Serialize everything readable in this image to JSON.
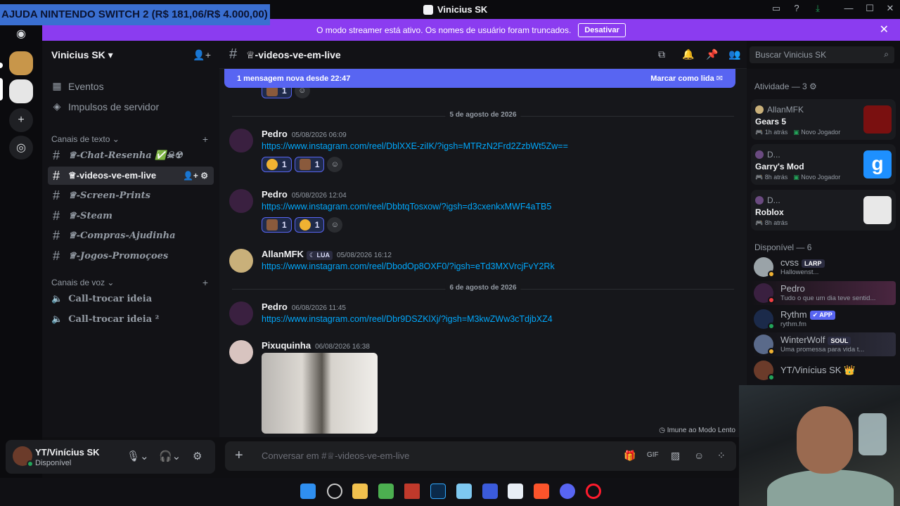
{
  "window": {
    "title": "Vinicius SK"
  },
  "stream_overlay_text": "AJUDA NINTENDO SWITCH 2 (R$ 181,06/R$ 4.000,00)",
  "streamer_bar": {
    "message": "O modo streamer está ativo. Os nomes de usuário foram truncados.",
    "button": "Desativar"
  },
  "server": {
    "name": "Vinicius SK"
  },
  "sidebar": {
    "events": "Eventos",
    "boosts": "Impulsos de servidor",
    "text_category": "Canais de texto",
    "voice_category": "Canais de voz",
    "text_channels": [
      "♕-Chat-Resenha ✅☠☢",
      "♕-videos-ve-em-live",
      "♕-Screen-Prints",
      "♕-Steam",
      "♕-Compras-Ajudinha",
      "♕-Jogos-Promoçoes"
    ],
    "voice_channels": [
      "Call-trocar ideia",
      "Call-trocar ideia ²"
    ]
  },
  "user_panel": {
    "name": "YT/Vinícius SK",
    "status": "Disponível"
  },
  "chat": {
    "channel_title": "♕-videos-ve-em-live",
    "new_messages": "1 mensagem nova desde 22:47",
    "mark_read": "Marcar como lida",
    "date_1": "5 de agosto de 2026",
    "date_2": "6 de agosto de 2026",
    "top_react_count": "1",
    "messages": [
      {
        "author": "Pedro",
        "time": "05/08/2026 06:09",
        "link": "https://www.instagram.com/reel/DblXXE-ziIK/?igsh=MTRzN2Frd2ZzbWt5Zw==",
        "react1": "1",
        "react2": "1"
      },
      {
        "author": "Pedro",
        "time": "05/08/2026 12:04",
        "link": "https://www.instagram.com/reel/DbbtqTosxow/?igsh=d3cxenkxMWF4aTB5",
        "react1": "1",
        "react2": "1"
      },
      {
        "author": "AllanMFK",
        "badge": "LUA",
        "time": "05/08/2026 16:12",
        "link": "https://www.instagram.com/reel/DbodOp8OXF0/?igsh=eTd3MXVrcjFvY2Rk"
      },
      {
        "author": "Pedro",
        "time": "06/08/2026 11:45",
        "link": "https://www.instagram.com/reel/Dbr9DSZKlXj/?igsh=M3kwZWw3cTdjbXZ4"
      },
      {
        "author": "Pixuquinha",
        "time": "06/08/2026 16:38"
      }
    ],
    "slow_mode": "Imune ao Modo Lento",
    "composer_placeholder": "Conversar em #♕-videos-ve-em-live"
  },
  "search": {
    "placeholder": "Buscar Vinicius SK"
  },
  "members": {
    "activity_header": "Atividade — 3",
    "activities": [
      {
        "user": "AllanMFK",
        "game": "Gears 5",
        "when": "1h atrás",
        "tag": "Novo Jogador"
      },
      {
        "user": "D...",
        "game": "Garry's Mod",
        "when": "8h atrás",
        "tag": "Novo Jogador"
      },
      {
        "user": "D...",
        "game": "Roblox",
        "when": "8h atrás"
      }
    ],
    "online_header": "Disponível — 6",
    "list": [
      {
        "name": "cvss",
        "badge": "LARP",
        "status": "Hallowenst..."
      },
      {
        "name": "Pedro",
        "status": "Tudo o que um dia teve sentid..."
      },
      {
        "name": "Rythm",
        "badge": "✔ APP",
        "status": "rythm.fm"
      },
      {
        "name": "WinterWolf",
        "badge": "SOUL",
        "status": "Uma promessa para vida t..."
      },
      {
        "name": "YT/Vinícius SK 👑"
      }
    ]
  },
  "colors": {
    "blurple": "#5865f2",
    "streamer_purple": "#8b3cf0",
    "link": "#00a8fc",
    "online": "#23a55a"
  }
}
